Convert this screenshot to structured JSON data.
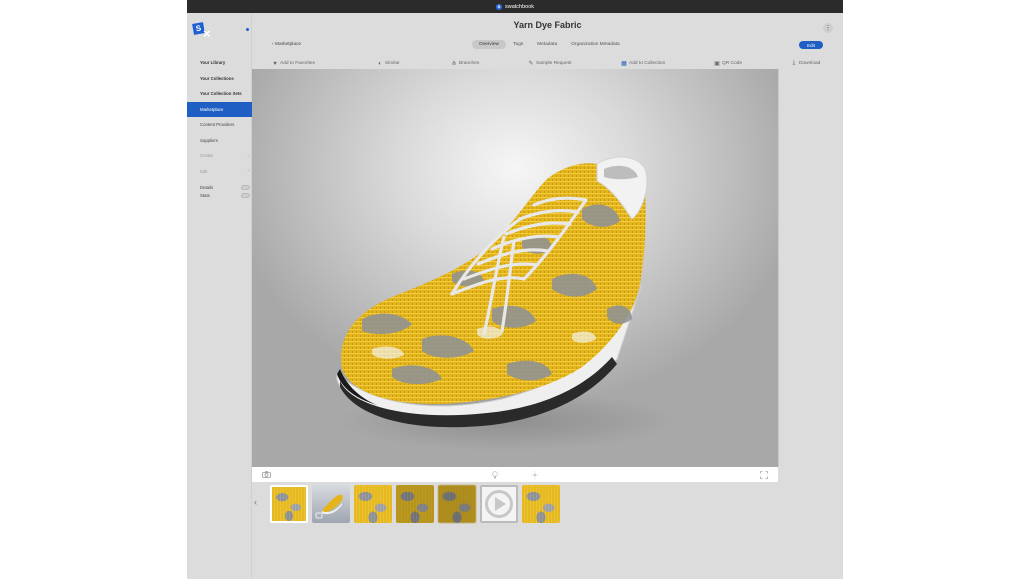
{
  "titlebar": {
    "app_name": "swatchbook",
    "app_icon_letter": "S"
  },
  "sidebar": {
    "logo_letter": "S",
    "items": [
      {
        "label": "Your Library"
      },
      {
        "label": "Your Collections"
      },
      {
        "label": "Your Collection Sets"
      },
      {
        "label": "Marketplace"
      },
      {
        "label": "Content Providers"
      },
      {
        "label": "Suppliers"
      },
      {
        "label": "Create"
      },
      {
        "label": "Edit"
      }
    ],
    "toggles": [
      {
        "label": "Details"
      },
      {
        "label": "Stats"
      }
    ]
  },
  "header": {
    "title": "Yarn Dye Fabric",
    "back_label": "Marketplace",
    "more_label": "⋮",
    "edit_label": "Edit",
    "tabs": [
      {
        "label": "Overview",
        "active": true
      },
      {
        "label": "Tags"
      },
      {
        "label": "Metadata"
      },
      {
        "label": "Organization Metadata"
      }
    ]
  },
  "toolbar": {
    "items": [
      {
        "label": "Add to Favorites",
        "icon": "heart-icon"
      },
      {
        "label": "Similar",
        "icon": "similar-icon"
      },
      {
        "label": "Branches",
        "icon": "branches-icon"
      },
      {
        "label": "Sample Request",
        "icon": "sample-icon"
      },
      {
        "label": "Add to Collection",
        "icon": "grid-icon"
      },
      {
        "label": "QR Code",
        "icon": "qr-icon"
      },
      {
        "label": "Download",
        "icon": "download-icon"
      }
    ]
  },
  "viewer": {
    "subject": "3D sneaker with yellow and grey yarn dye fabric",
    "icons": [
      "camera-icon",
      "light-icon",
      "sun-icon",
      "fullscreen-icon"
    ]
  },
  "thumbnails": [
    {
      "kind": "fabric",
      "selected": true
    },
    {
      "kind": "shoe-3d"
    },
    {
      "kind": "fabric"
    },
    {
      "kind": "fabric"
    },
    {
      "kind": "fabric"
    },
    {
      "kind": "video"
    },
    {
      "kind": "fabric"
    }
  ],
  "colors": {
    "accent": "#1f5fc4",
    "fabric_yellow": "#e6b91f",
    "fabric_grey": "#8f9294",
    "background": "#dcdcdc"
  }
}
